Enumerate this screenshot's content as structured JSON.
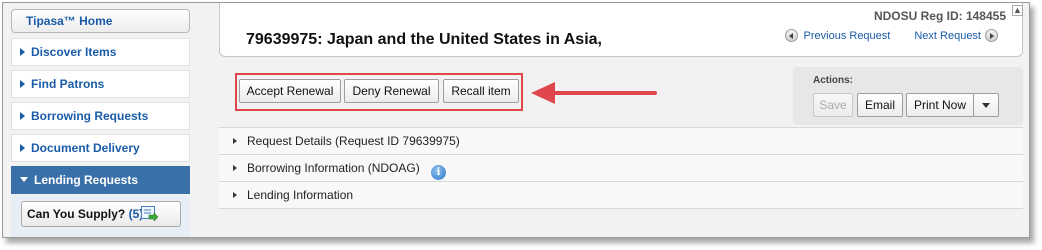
{
  "sidebar": {
    "home_label": "Tipasa™ Home",
    "items": [
      {
        "label": "Discover Items"
      },
      {
        "label": "Find Patrons"
      },
      {
        "label": "Borrowing Requests"
      },
      {
        "label": "Document Delivery"
      },
      {
        "label": "Lending Requests"
      }
    ],
    "active_index": 4,
    "sub": {
      "label": "Can You Supply?",
      "count": "(5)"
    }
  },
  "header": {
    "reg_id": "NDOSU Reg ID: 148455",
    "title": "79639975: Japan and the United States in Asia,",
    "prev_label": "Previous Request",
    "next_label": "Next Request"
  },
  "request_actions": {
    "accept_label": "Accept Renewal",
    "deny_label": "Deny Renewal",
    "recall_label": "Recall item"
  },
  "actions_panel": {
    "label": "Actions:",
    "save_label": "Save",
    "email_label": "Email",
    "print_label": "Print Now"
  },
  "sections": [
    {
      "label": "Request Details (Request ID 79639975)"
    },
    {
      "label": "Borrowing Information (NDOAG)",
      "info_glyph": "i"
    },
    {
      "label": "Lending Information"
    }
  ],
  "colors": {
    "link_blue": "#1a5ca8",
    "active_nav": "#3a70aa",
    "highlight_red": "#e0474c",
    "info_blue": "#2c78c8"
  },
  "icons": {
    "expand": "triangle-right-icon",
    "collapse": "triangle-down-icon",
    "prev": "circle-arrow-left-icon",
    "next": "circle-arrow-right-icon",
    "info": "info-icon",
    "supply": "green-arrow-list-icon",
    "annotation": "red-arrow-left"
  }
}
